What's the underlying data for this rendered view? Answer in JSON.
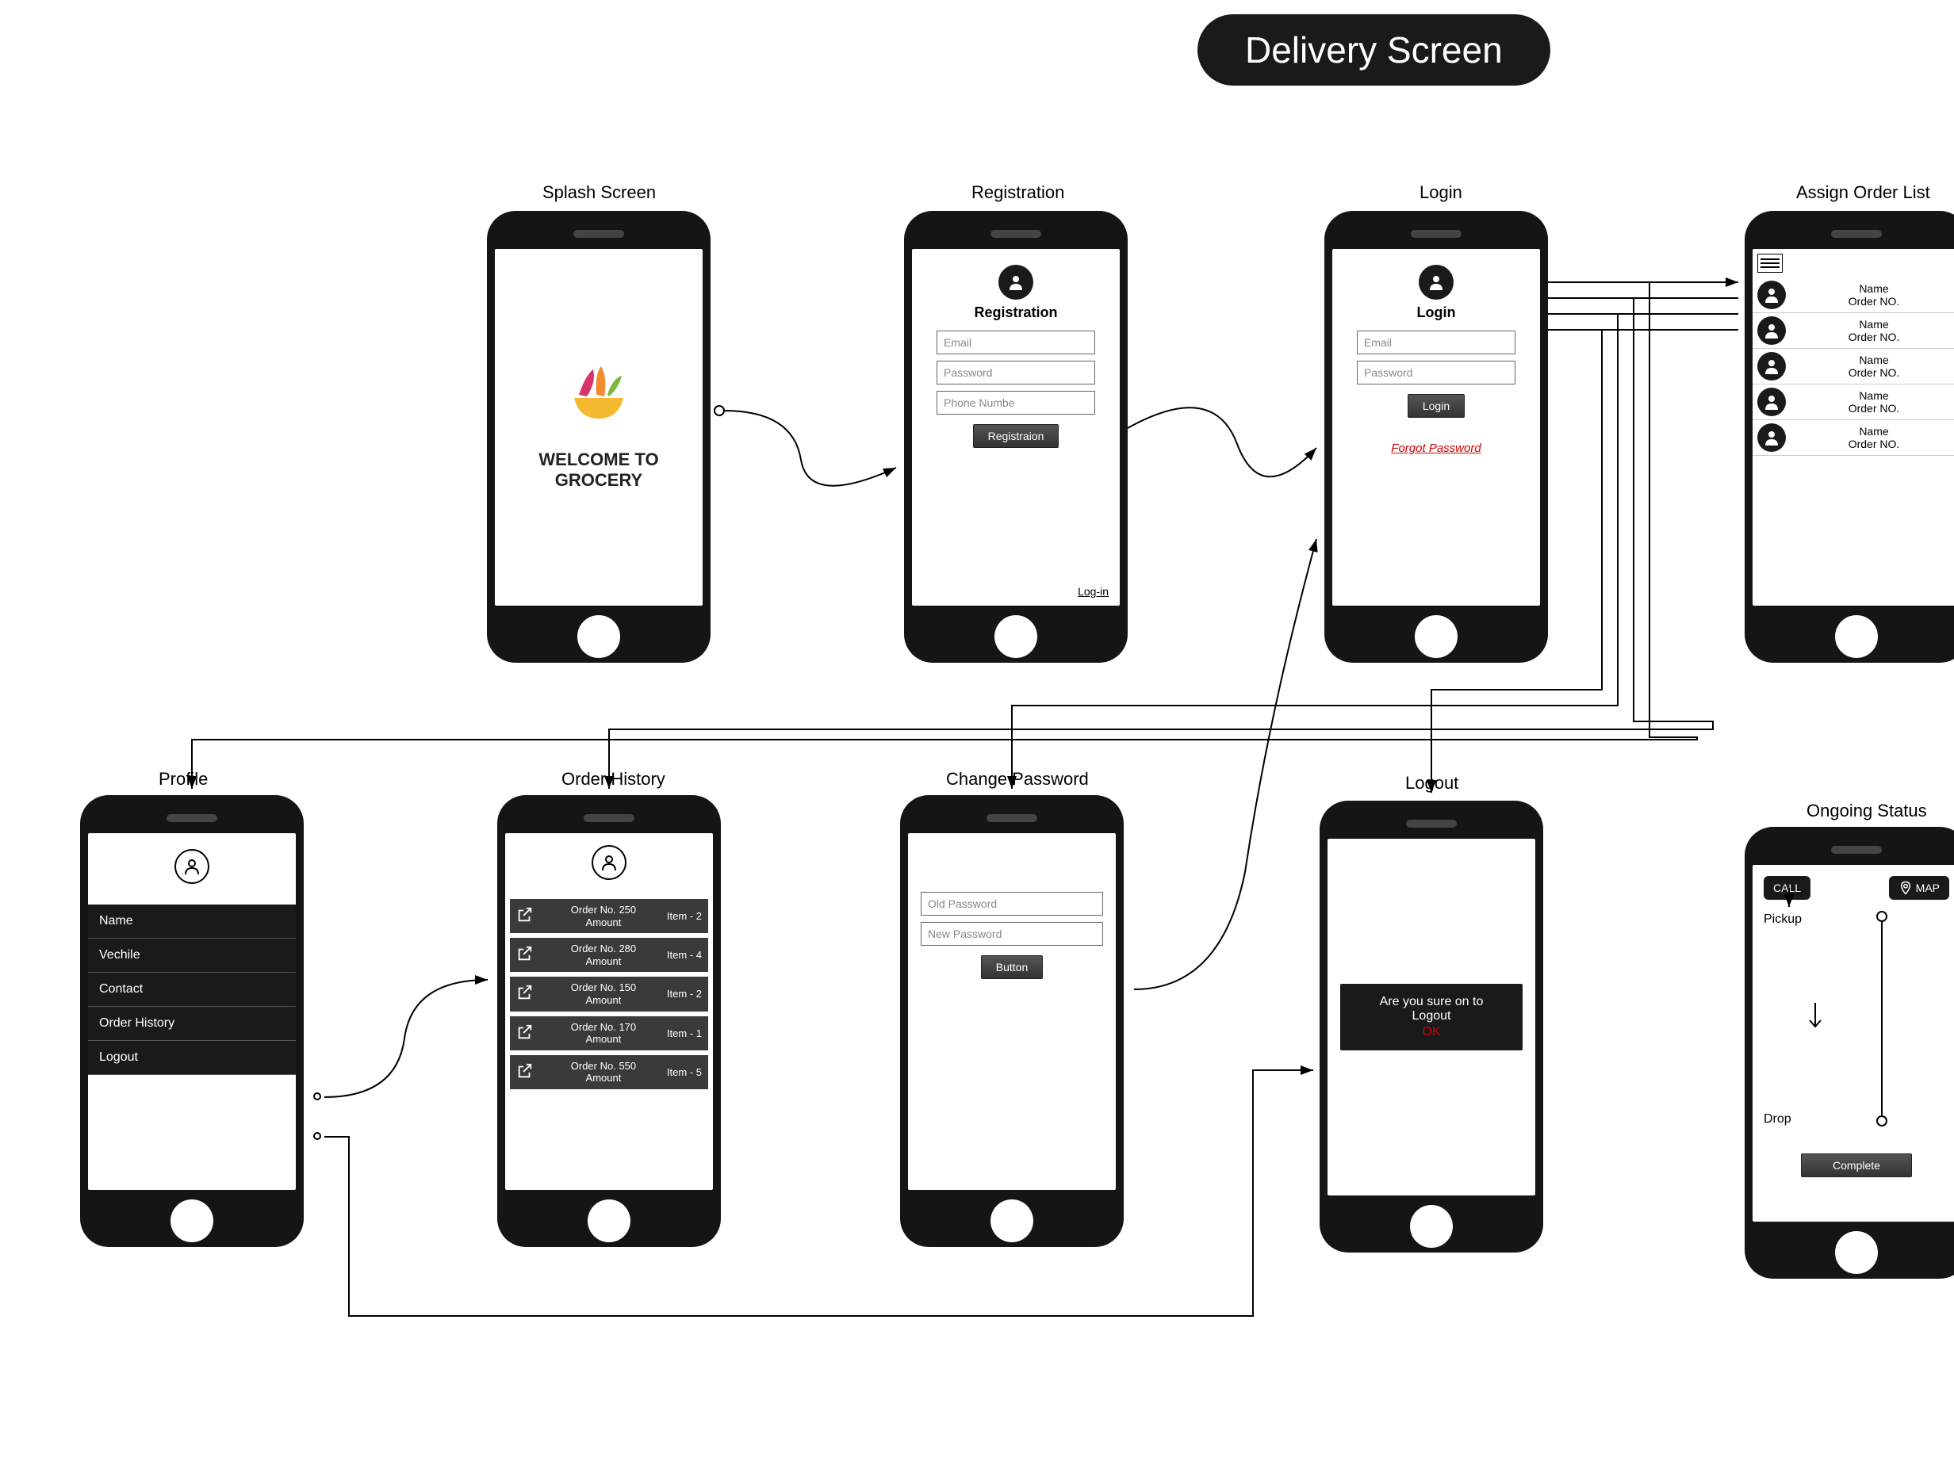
{
  "title": "Delivery Screen",
  "captions": {
    "splash": "Splash Screen",
    "registration": "Registration",
    "login": "Login",
    "assign": "Assign Order List",
    "profile": "Profile",
    "history": "Order History",
    "changepw": "Change Password",
    "logout": "Logout",
    "ongoing": "Ongoing Status"
  },
  "splash": {
    "line1": "WELCOME TO",
    "line2": "GROCERY"
  },
  "registration": {
    "heading": "Registration",
    "email": "Email",
    "password": "Password",
    "phone": "Phone Numbe",
    "button": "Registraion",
    "login_link": "Log-in"
  },
  "login": {
    "heading": "Login",
    "email": "Email",
    "password": "Password",
    "button": "Login",
    "forgot": "Forgot Password"
  },
  "assign": {
    "rows": [
      {
        "name": "Name",
        "order": "Order NO."
      },
      {
        "name": "Name",
        "order": "Order NO."
      },
      {
        "name": "Name",
        "order": "Order NO."
      },
      {
        "name": "Name",
        "order": "Order NO."
      },
      {
        "name": "Name",
        "order": "Order NO."
      }
    ]
  },
  "profile": {
    "items": [
      "Name",
      "Vechile",
      "Contact",
      "Order History",
      "Logout"
    ]
  },
  "history": {
    "items": [
      {
        "order": "Order No. 250",
        "amount": "Amount",
        "items": "Item - 2"
      },
      {
        "order": "Order No. 280",
        "amount": "Amount",
        "items": "Item - 4"
      },
      {
        "order": "Order No. 150",
        "amount": "Amount",
        "items": "Item - 2"
      },
      {
        "order": "Order No. 170",
        "amount": "Amount",
        "items": "Item - 1"
      },
      {
        "order": "Order No. 550",
        "amount": "Amount",
        "items": "Item - 5"
      }
    ]
  },
  "changepw": {
    "old": "Old Password",
    "new": "New Password",
    "button": "Button"
  },
  "logoutDialog": {
    "line1": "Are you sure on to",
    "line2": "Logout",
    "ok": "OK"
  },
  "ongoing": {
    "call": "CALL",
    "map": "MAP",
    "pickup": "Pickup",
    "drop": "Drop",
    "complete": "Complete"
  }
}
